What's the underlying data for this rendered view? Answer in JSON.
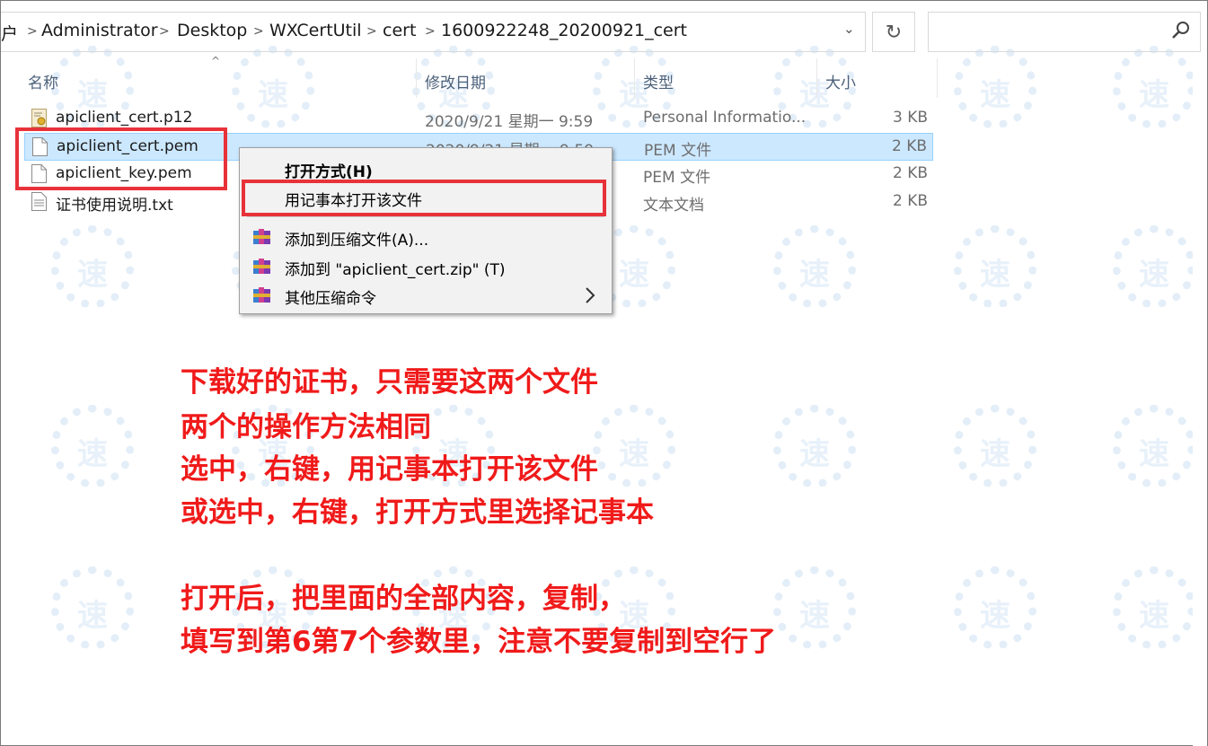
{
  "breadcrumb": {
    "leading": "户",
    "items": [
      "Administrator",
      "Desktop",
      "WXCertUtil",
      "cert",
      "1600922248_20200921_cert"
    ]
  },
  "icons": {
    "separator": "chevron-right-icon",
    "dropdown": "chevron-down-icon",
    "refresh": "refresh-icon",
    "search": "search-icon"
  },
  "columns": {
    "name": "名称",
    "modified": "修改日期",
    "type": "类型",
    "size": "大小"
  },
  "files": [
    {
      "name": "apiclient_cert.p12",
      "date": "2020/9/21 星期一 9:59",
      "type": "Personal Informatio...",
      "size": "3 KB",
      "icon": "certificate-file-icon",
      "selected": false
    },
    {
      "name": "apiclient_cert.pem",
      "date": "2020/9/21 星期一 9:59",
      "type": "PEM 文件",
      "size": "2 KB",
      "icon": "document-file-icon",
      "selected": true
    },
    {
      "name": "apiclient_key.pem",
      "date": "",
      "type": "PEM 文件",
      "size": "2 KB",
      "icon": "document-file-icon",
      "selected": false
    },
    {
      "name": "证书使用说明.txt",
      "date": "",
      "type": "文本文档",
      "size": "2 KB",
      "icon": "text-file-icon",
      "selected": false
    }
  ],
  "context_menu": {
    "items": [
      {
        "label": "打开方式(H)",
        "bold": true
      },
      {
        "label": "用记事本打开该文件",
        "bold": false,
        "highlighted": true
      },
      {
        "label": "添加到压缩文件(A)...",
        "icon": "winrar-archive-icon"
      },
      {
        "label": "添加到 \"apiclient_cert.zip\" (T)",
        "icon": "winrar-archive-icon"
      },
      {
        "label": "其他压缩命令",
        "icon": "winrar-archive-icon",
        "submenu": true
      }
    ]
  },
  "watermark": "速",
  "annotation": {
    "lines": [
      "下载好的证书，只需要这两个文件",
      "两个的操作方法相同",
      "选中，右键，用记事本打开该文件",
      "或选中，右键，打开方式里选择记事本",
      "",
      "打开后，把里面的全部内容，复制，",
      "填写到第6第7个参数里，注意不要复制到空行了"
    ],
    "color": "#f01a1a"
  },
  "colors": {
    "selection": "#cce8ff",
    "highlight_box": "#e8323a",
    "header_text": "#4c607a"
  }
}
